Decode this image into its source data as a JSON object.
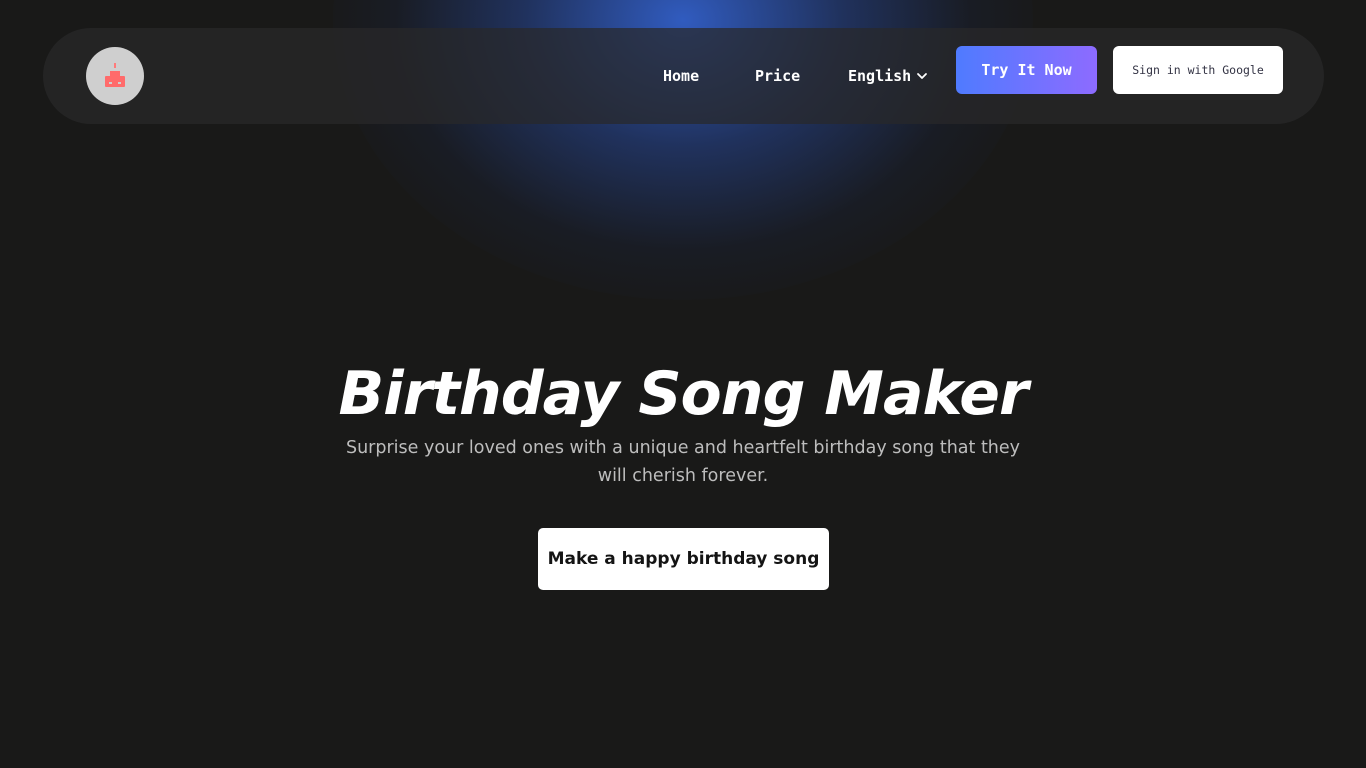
{
  "header": {
    "logo": {
      "icon": "birthday-cake-icon"
    },
    "nav": {
      "home_label": "Home",
      "price_label": "Price",
      "language_label": "English"
    },
    "try_button_label": "Try It Now",
    "google_button_label": "Sign in with Google"
  },
  "hero": {
    "title": "Birthday Song Maker",
    "subtitle": "Surprise your loved ones with a unique and heartfelt birthday song that they will cherish forever.",
    "cta_label": "Make a happy birthday song"
  },
  "colors": {
    "background": "#191918",
    "glow": "#325fc8",
    "accent_gradient_start": "#4f7bff",
    "accent_gradient_end": "#8d6bff",
    "logo_cake": "#ff6b6b"
  }
}
